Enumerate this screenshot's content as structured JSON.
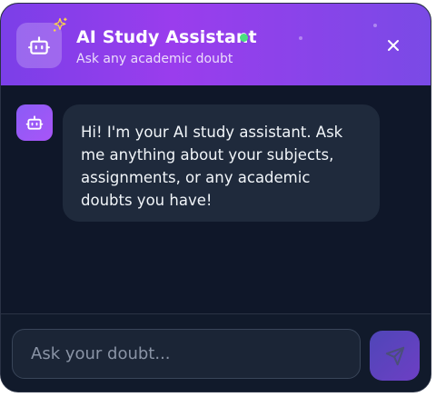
{
  "header": {
    "title": "AI Study Assistant",
    "subtitle": "Ask any academic doubt",
    "status": "online",
    "avatar_icon": "robot-icon",
    "decoration_icon": "sparkle-icon",
    "close_icon": "close-icon"
  },
  "messages": [
    {
      "sender": "bot",
      "avatar_icon": "robot-icon",
      "text": "Hi! I'm your AI study assistant. Ask me anything about your subjects, assignments, or any academic doubts you have!"
    }
  ],
  "composer": {
    "placeholder": "Ask your doubt...",
    "value": "",
    "send_icon": "send-icon"
  },
  "colors": {
    "header_gradient_start": "#7b3fe8",
    "header_gradient_end": "#7a4ae6",
    "background": "#0f1729",
    "bubble": "#1f2a3c",
    "status_online": "#4ade80",
    "accent": "#8b5cf6"
  }
}
